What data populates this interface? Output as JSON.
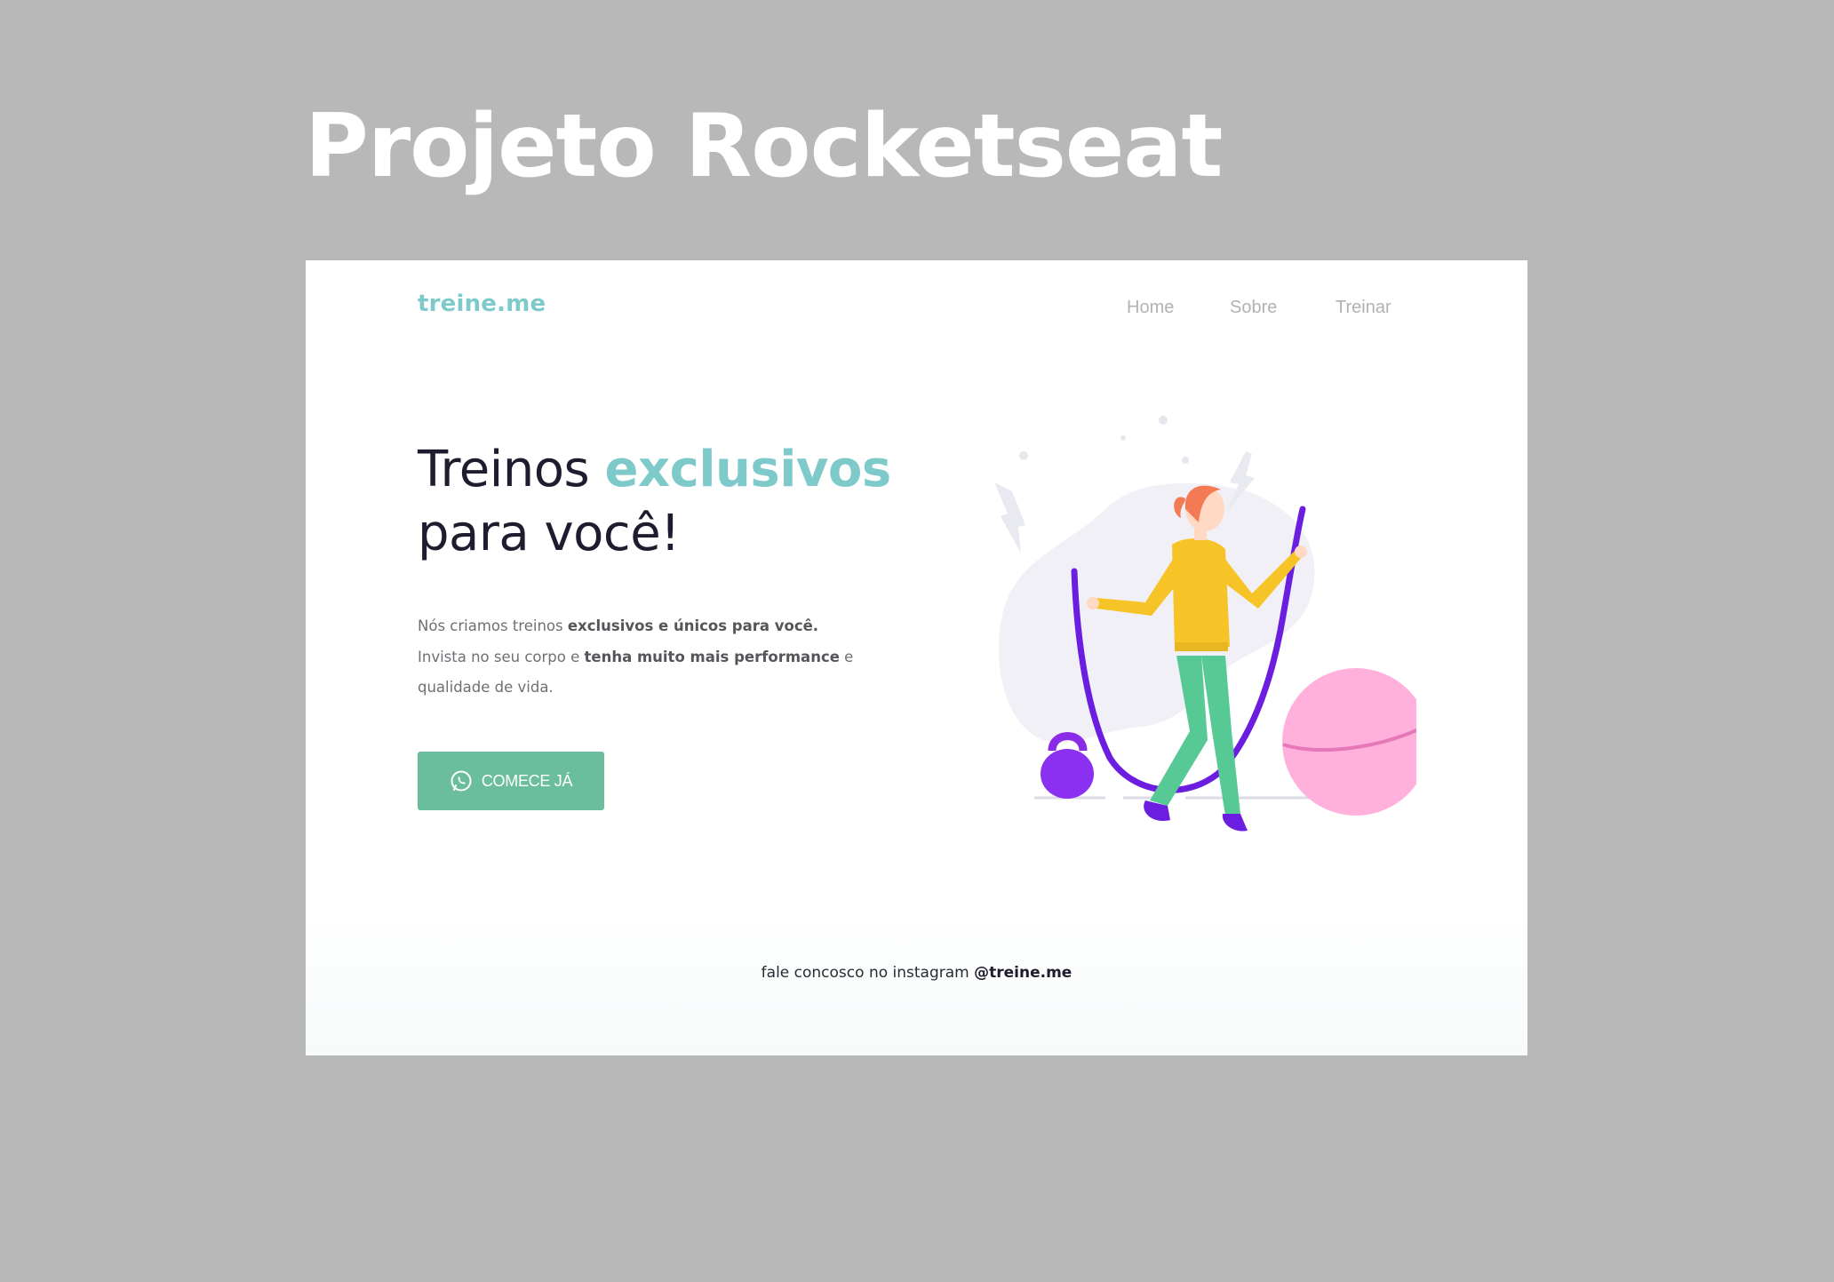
{
  "page": {
    "heading": "Projeto Rocketseat"
  },
  "site": {
    "logo": "treine.me",
    "nav": [
      {
        "label": "Home"
      },
      {
        "label": "Sobre"
      },
      {
        "label": "Treinar"
      }
    ],
    "hero": {
      "title_part1": "Treinos ",
      "title_accent": "exclusivos",
      "title_part2": "para você!",
      "text_1": "Nós criamos treinos ",
      "text_1_bold": "exclusivos e únicos para você.",
      "text_2": "Invista no seu corpo e ",
      "text_2_bold": "tenha muito mais performance",
      "text_2_end": " e",
      "text_3": "qualidade de vida.",
      "cta_label": "COMECE JÁ",
      "cta_icon": "whatsapp-icon"
    },
    "footer": {
      "text": "fale concosco no instagram ",
      "handle": "@treine.me"
    }
  },
  "colors": {
    "background": "#b8b8b8",
    "accent": "#7ecacb",
    "button": "#6abe9e",
    "title_dark": "#1e1c2e",
    "rope": "#6b1ee0",
    "ball": "#ffb1dc",
    "pants": "#56c994",
    "jacket": "#f7c427",
    "hair": "#f47a55"
  }
}
